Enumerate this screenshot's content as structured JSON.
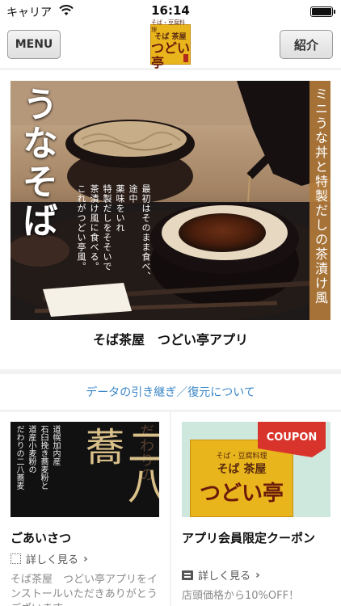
{
  "status": {
    "carrier": "キャリア",
    "time": "16:14",
    "battery_level": 1.0
  },
  "nav": {
    "menu_label": "MENU",
    "intro_label": "紹介",
    "logo_small": "そば・豆腐料理",
    "logo_line1": "そば 茶屋",
    "logo_line2": "つどい亭"
  },
  "hero": {
    "big_title": "うなそば",
    "side_text": "ミニうな丼と特製だしの茶漬け風",
    "desc_lines": [
      "最初はそのまま食べ、",
      "途中",
      "薬味をいれ",
      "特製だしをそそいで",
      "茶漬け風に食べる。",
      "これがつどい亭風。"
    ],
    "caption": "そば茶屋　つどい亭アプリ"
  },
  "data_link": "データの引き継ぎ／復元について",
  "cards": [
    {
      "title": "ごあいさつ",
      "more": "詳しく見る",
      "desc": "そば茶屋　つどい亭アプリをインストールいただきありがとうございます。",
      "thumb_lines": [
        "道幌加内産",
        "石臼挽き蕎麦粉と",
        "道産小麦粉の",
        "だわりの二八蕎麦"
      ],
      "thumb_big": "二八蕎",
      "thumb_top": "だわりの"
    },
    {
      "title": "アプリ会員限定クーポン",
      "more": "詳しく見る",
      "desc": "店頭価格から10%OFF！",
      "ribbon": "COUPON",
      "logo_small": "そば・豆腐料理",
      "logo_line1": "そば 茶屋",
      "logo_line2": "つどい亭"
    }
  ],
  "colors": {
    "accent": "#3a86c8",
    "logo_bg": "#e9b51c",
    "coupon_red": "#d9342b"
  }
}
